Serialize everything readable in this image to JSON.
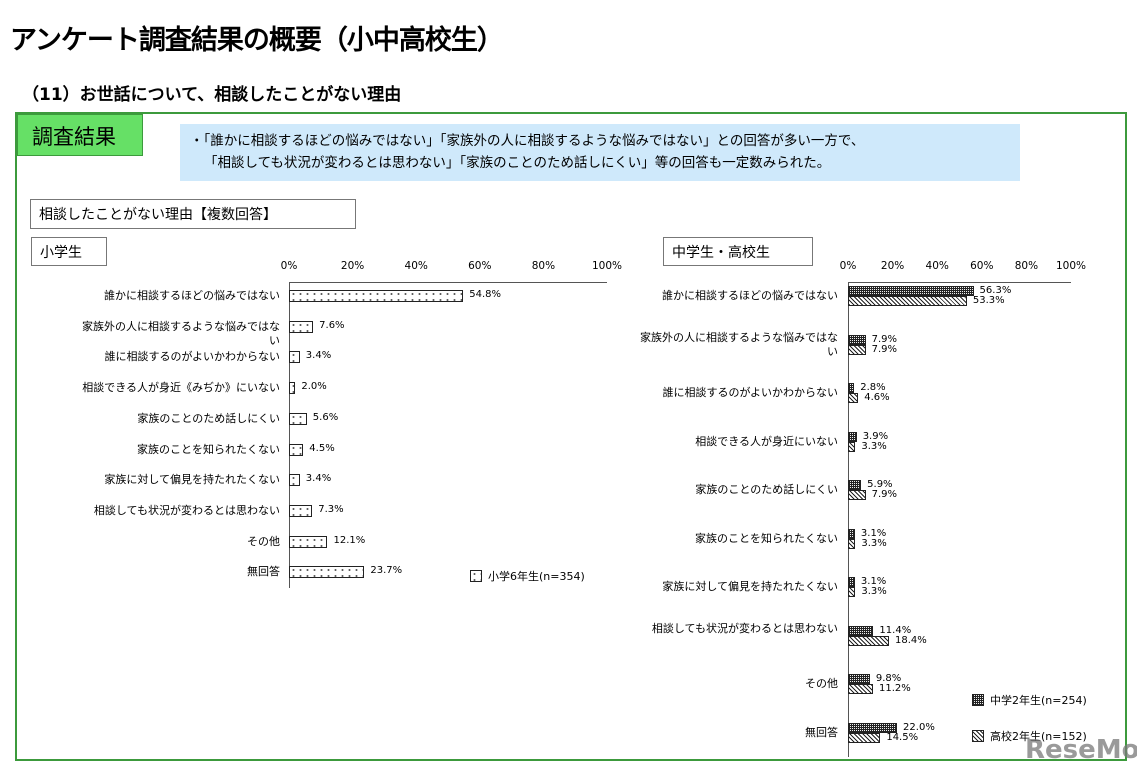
{
  "header": {
    "title": "アンケート調査結果の概要（小中高校生）",
    "subtitle": "（11）お世話について、相談したことがない理由",
    "result_label": "調査結果",
    "summary_line1": "・「誰かに相談するほどの悩みではない」「家族外の人に相談するような悩みではない」との回答が多い一方で、",
    "summary_line2": "「相談しても状況が変わるとは思わない」「家族のことのため話しにくい」等の回答も一定数みられた。",
    "chart_heading": "相談したことがない理由【複数回答】",
    "watermark": "ReseMom"
  },
  "chart_data": [
    {
      "type": "bar",
      "orientation": "horizontal",
      "title": "小学生",
      "xlim": [
        0,
        100
      ],
      "x_ticks": [
        "0%",
        "20%",
        "40%",
        "60%",
        "80%",
        "100%"
      ],
      "categories": [
        "誰かに相談するほどの悩みではない",
        "家族外の人に相談するような悩みではない",
        "誰に相談するのがよいかわからない",
        "相談できる人が身近《みぢか》にいない",
        "家族のことのため話しにくい",
        "家族のことを知られたくない",
        "家族に対して偏見を持たれたくない",
        "相談しても状況が変わるとは思わない",
        "その他",
        "無回答"
      ],
      "series": [
        {
          "name": "小学6年生(n=354)",
          "values": [
            54.8,
            7.6,
            3.4,
            2.0,
            5.6,
            4.5,
            3.4,
            7.3,
            12.1,
            23.7
          ]
        }
      ],
      "legend": "bottom-right"
    },
    {
      "type": "bar",
      "orientation": "horizontal",
      "title": "中学生・高校生",
      "xlim": [
        0,
        100
      ],
      "x_ticks": [
        "0%",
        "20%",
        "40%",
        "60%",
        "80%",
        "100%"
      ],
      "categories": [
        "誰かに相談するほどの悩みではない",
        "家族外の人に相談するような悩みではない",
        "誰に相談するのがよいかわからない",
        "相談できる人が身近にいない",
        "家族のことのため話しにくい",
        "家族のことを知られたくない",
        "家族に対して偏見を持たれたくない",
        "相談しても状況が変わるとは思わない",
        "その他",
        "無回答"
      ],
      "series": [
        {
          "name": "中学2年生(n=254)",
          "values": [
            56.3,
            7.9,
            2.8,
            3.9,
            5.9,
            3.1,
            3.1,
            11.4,
            9.8,
            22.0
          ]
        },
        {
          "name": "高校2年生(n=152)",
          "values": [
            53.3,
            7.9,
            4.6,
            3.3,
            7.9,
            3.3,
            3.3,
            18.4,
            11.2,
            14.5
          ]
        }
      ],
      "legend": "bottom-right"
    }
  ]
}
